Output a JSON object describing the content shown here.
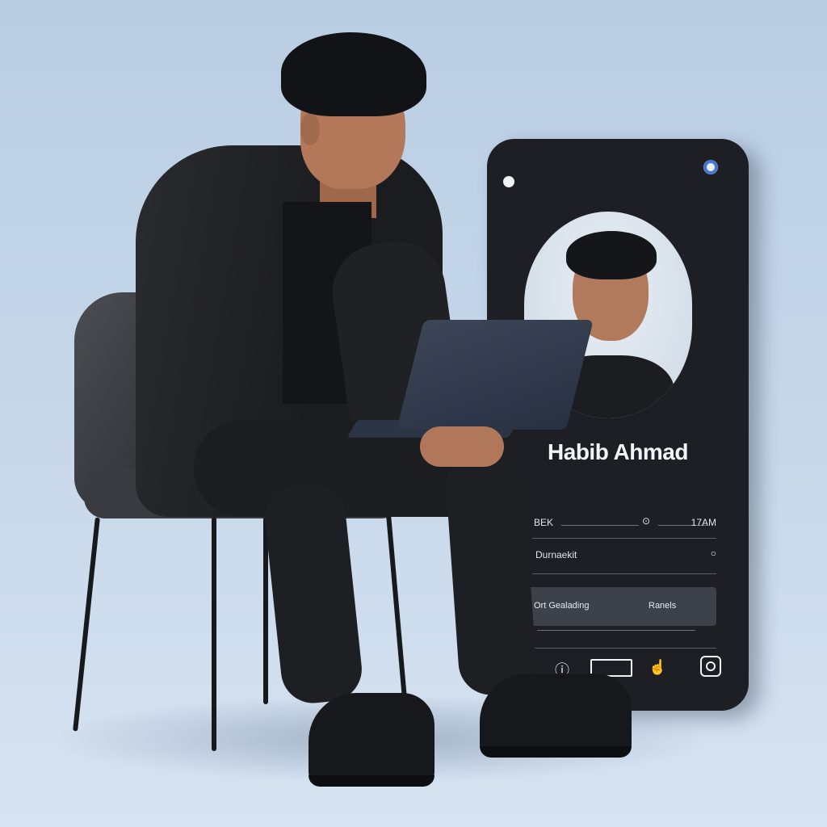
{
  "profile": {
    "name": "Habib Ahmad",
    "subtitle": "",
    "row1_label": "BEK",
    "row1_value": "17AM",
    "row2_label": "Durnaekit",
    "search_text": "Ort Gealading",
    "search_right": "Ranels"
  },
  "icons": {
    "apple": "apple-logo"
  },
  "colors": {
    "background": "#c4d5e8",
    "phone": "#1d1f24",
    "text_light": "#f2f4f7"
  }
}
